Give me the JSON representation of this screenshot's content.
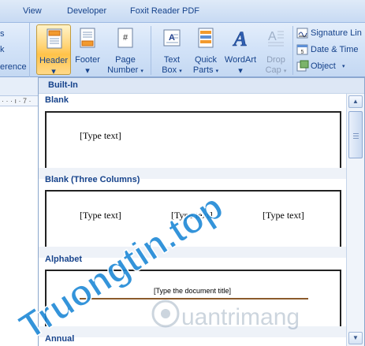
{
  "tabs": [
    "View",
    "Developer",
    "Foxit Reader PDF"
  ],
  "left_fragments": [
    "s",
    "k",
    "erence"
  ],
  "ribbon": {
    "header": {
      "label": "Header",
      "arrow": "▾"
    },
    "footer": {
      "label": "Footer",
      "arrow": "▾"
    },
    "page_number": {
      "label": "Page",
      "label2": "Number",
      "arrow": "▾"
    },
    "text_box": {
      "label": "Text",
      "label2": "Box",
      "arrow": "▾"
    },
    "quick_parts": {
      "label": "Quick",
      "label2": "Parts",
      "arrow": "▾"
    },
    "wordart": {
      "label": "WordArt",
      "arrow": "▾"
    },
    "drop_cap": {
      "label": "Drop",
      "label2": "Cap",
      "arrow": "▾"
    },
    "signature_line": {
      "label": "Signature Lin"
    },
    "date_time": {
      "label": "Date & Time"
    },
    "object": {
      "label": "Object",
      "arrow": "▾"
    }
  },
  "ruler_marks": "· · · ı · 7 ·",
  "gallery": {
    "group": "Built-In",
    "sections": [
      {
        "title": "Blank",
        "placeholders": [
          "[Type text]"
        ]
      },
      {
        "title": "Blank (Three Columns)",
        "placeholders": [
          "[Type text]",
          "[Type text]",
          "[Type text]"
        ]
      },
      {
        "title": "Alphabet",
        "placeholders": [
          "[Type the document title]"
        ]
      },
      {
        "title": "Annual",
        "placeholders": []
      }
    ],
    "scroll_up": "▲",
    "scroll_down": "▼"
  },
  "watermarks": {
    "main": "Truongtin.top",
    "secondary": "uantrimang"
  },
  "colors": {
    "accent_active": "#ffc34a",
    "ribbon_text": "#15428b",
    "rule": "#8b5a2b",
    "watermark": "#1e88d6"
  }
}
